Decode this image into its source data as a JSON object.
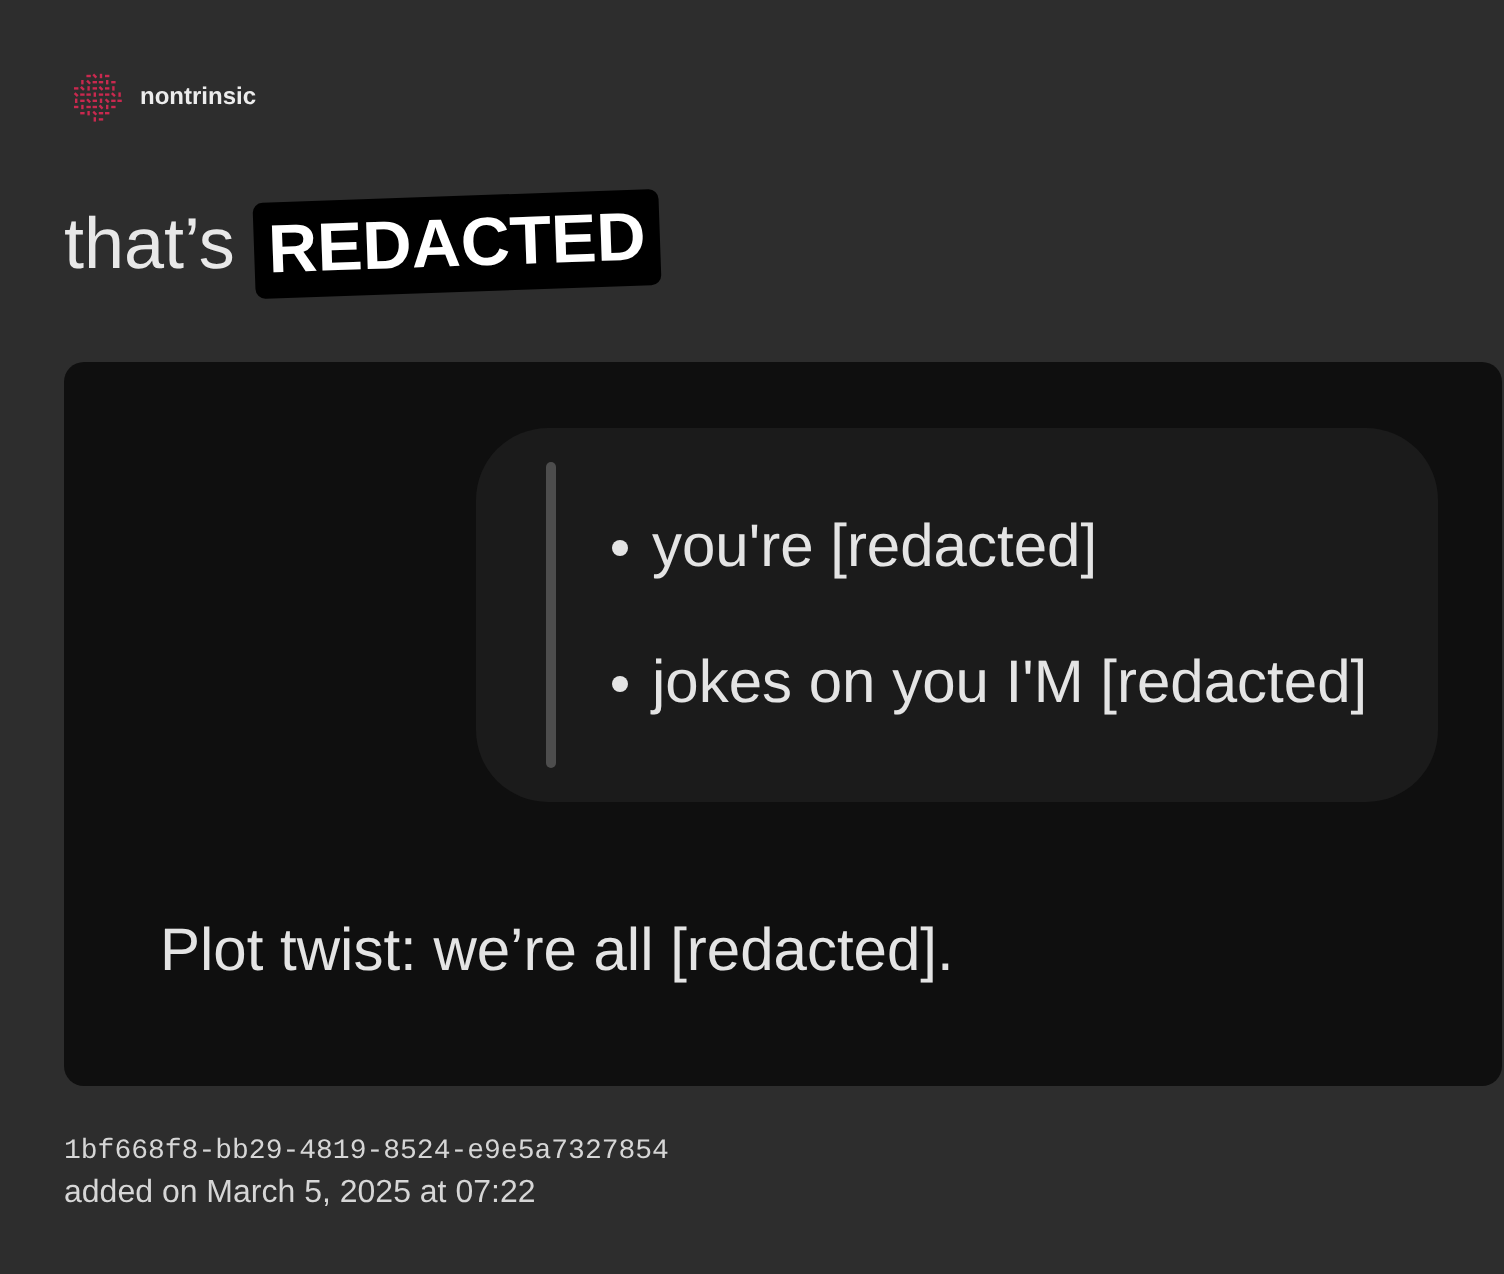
{
  "brand": {
    "name": "nontrinsic"
  },
  "headline": {
    "text": "that’s",
    "badge": "REDACTED"
  },
  "message": {
    "quote_items": [
      "you're [redacted]",
      "jokes on you I'M [redacted]"
    ],
    "body": "Plot twist: we’re all [redacted]."
  },
  "meta": {
    "id": "1bf668f8-bb29-4819-8524-e9e5a7327854",
    "added": "added on March 5, 2025 at 07:22"
  }
}
